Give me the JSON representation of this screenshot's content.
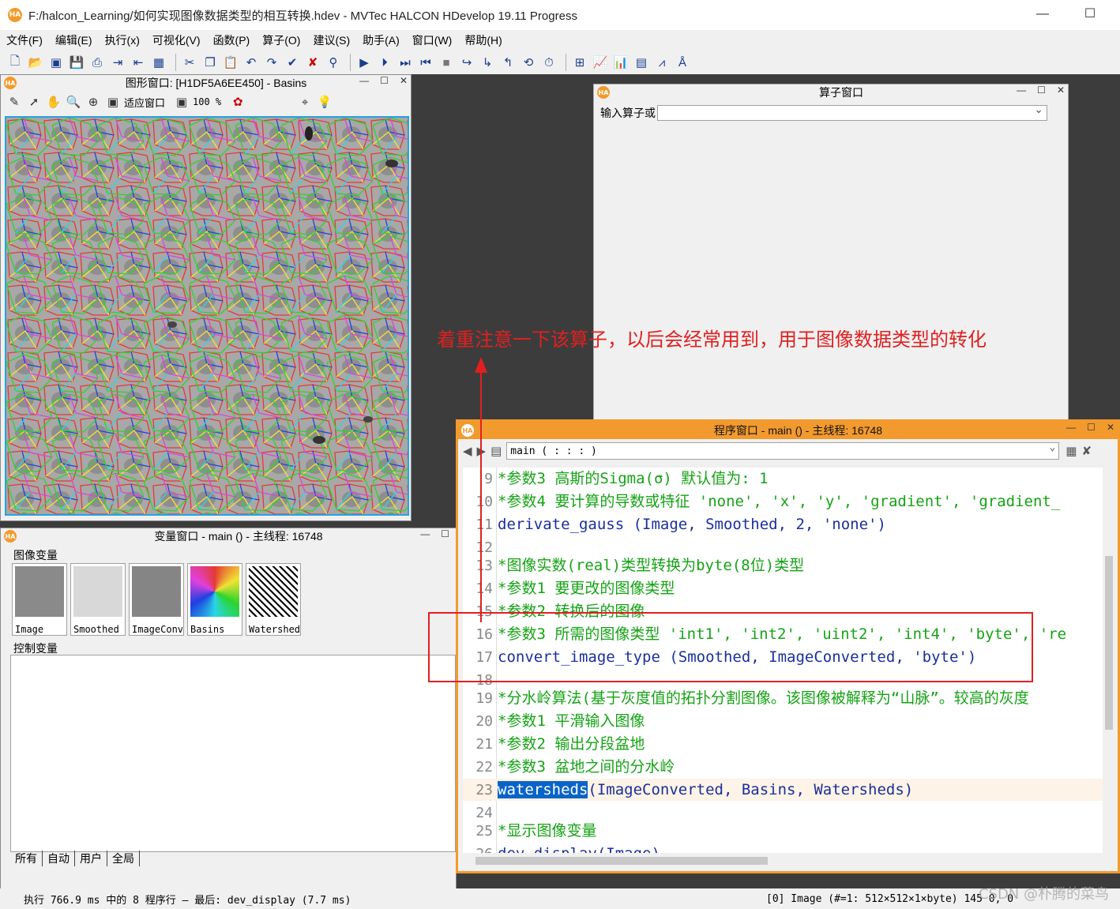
{
  "window": {
    "title": "F:/halcon_Learning/如何实现图像数据类型的相互转换.hdev - MVTec HALCON HDevelop 19.11 Progress",
    "logo": "HA"
  },
  "menu": [
    "文件(F)",
    "编辑(E)",
    "执行(x)",
    "可视化(V)",
    "函数(P)",
    "算子(O)",
    "建议(S)",
    "助手(A)",
    "窗口(W)",
    "帮助(H)"
  ],
  "graphics_window": {
    "title": "图形窗口: [H1DF5A6EE450] - Basins",
    "fit_label": "适应窗口",
    "zoom_label": "100 %"
  },
  "operator_window": {
    "title": "算子窗口",
    "input_label": "输入算子或",
    "input_value": ""
  },
  "variable_window": {
    "title": "变量窗口 - main () - 主线程: 16748",
    "image_group": "图像变量",
    "control_group": "控制变量",
    "images": [
      "Image",
      "Smoothed",
      "ImageConverted",
      "Basins",
      "Watersheds"
    ],
    "tabs": [
      "所有",
      "自动",
      "用户",
      "全局"
    ]
  },
  "program_window": {
    "title": "程序窗口 - main () - 主线程: 16748",
    "procedure": "main ( : : : )",
    "lines": [
      {
        "n": "9",
        "parts": [
          {
            "t": "*参数3 高斯的Sigma(σ) 默认值为: 1",
            "c": "c-comment"
          }
        ]
      },
      {
        "n": "10",
        "parts": [
          {
            "t": "*参数4 要计算的导数或特征 'none', 'x', 'y', 'gradient', 'gradient_",
            "c": "c-comment"
          }
        ]
      },
      {
        "n": "11",
        "parts": [
          {
            "t": "derivate_gauss (Image, Smoothed, 2, ",
            "c": "c-op"
          },
          {
            "t": "'none'",
            "c": "c-op"
          },
          {
            "t": ")",
            "c": "c-op"
          }
        ]
      },
      {
        "n": "12",
        "parts": []
      },
      {
        "n": "13",
        "parts": [
          {
            "t": "*图像实数(real)类型转换为byte(8位)类型",
            "c": "c-comment"
          }
        ]
      },
      {
        "n": "14",
        "parts": [
          {
            "t": "*参数1 要更改的图像类型",
            "c": "c-comment"
          }
        ]
      },
      {
        "n": "15",
        "parts": [
          {
            "t": "*参数2 转换后的图像",
            "c": "c-comment"
          }
        ]
      },
      {
        "n": "16",
        "parts": [
          {
            "t": "*参数3 所需的图像类型 'int1', 'int2', 'uint2', 'int4', 'byte', 're",
            "c": "c-comment"
          }
        ]
      },
      {
        "n": "17",
        "parts": [
          {
            "t": "convert_image_type (Smoothed, ImageConverted, ",
            "c": "c-op"
          },
          {
            "t": "'byte'",
            "c": "c-op"
          },
          {
            "t": ")",
            "c": "c-op"
          }
        ]
      },
      {
        "n": "18",
        "parts": []
      },
      {
        "n": "19",
        "parts": [
          {
            "t": "*分水岭算法(基于灰度值的拓扑分割图像。该图像被解释为“山脉”。较高的灰度",
            "c": "c-comment"
          }
        ]
      },
      {
        "n": "20",
        "parts": [
          {
            "t": "*参数1 平滑输入图像",
            "c": "c-comment"
          }
        ]
      },
      {
        "n": "21",
        "parts": [
          {
            "t": "*参数2 输出分段盆地",
            "c": "c-comment"
          }
        ]
      },
      {
        "n": "22",
        "parts": [
          {
            "t": "*参数3 盆地之间的分水岭",
            "c": "c-comment"
          }
        ]
      },
      {
        "n": "23",
        "parts": [
          {
            "t": "watersheds",
            "c": "c-hl"
          },
          {
            "t": "(ImageConverted, Basins, Watersheds)",
            "c": "c-op"
          }
        ]
      },
      {
        "n": "24",
        "parts": []
      },
      {
        "n": "25",
        "parts": [
          {
            "t": "*显示图像变量",
            "c": "c-comment"
          }
        ]
      },
      {
        "n": "26",
        "parts": [
          {
            "t": "dev_display(Image)",
            "c": "c-op"
          }
        ]
      }
    ]
  },
  "annotation": {
    "text": "着重注意一下该算子，以后会经常用到，用于图像数据类型的转化"
  },
  "status": {
    "left": "执行 766.9 ms 中的 8 程序行 — 最后: dev_display (7.7 ms)",
    "right": "[0] Image (#=1: 512×512×1×byte)  145  0, 0"
  },
  "watermark": "CSDN @朴腾的菜鸟",
  "colors": {
    "accent_orange": "#f29a2e",
    "annotation_red": "#e02020",
    "comment_green": "#15a315",
    "operator_blue": "#1a2f9e",
    "selection_blue": "#0a64c8"
  }
}
